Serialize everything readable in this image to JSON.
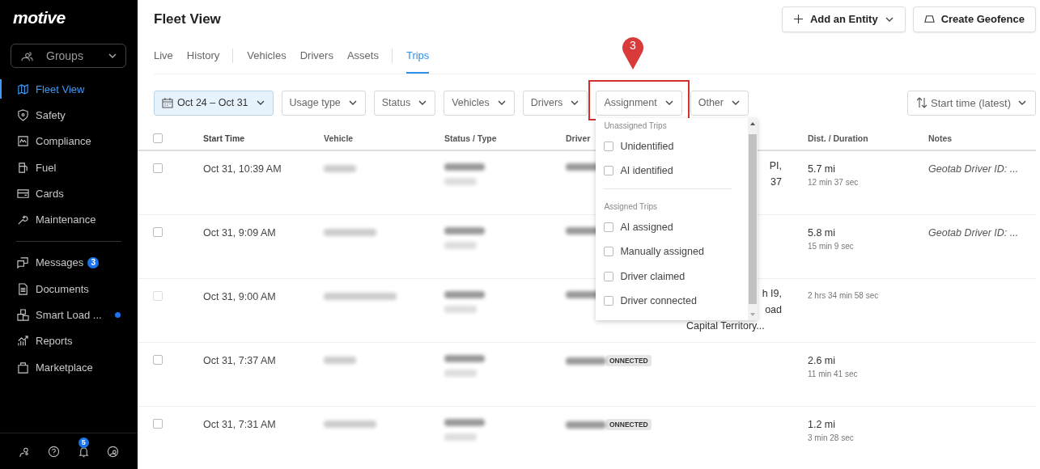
{
  "sidebar": {
    "logo": "motive",
    "groups": {
      "label": "Groups"
    },
    "nav": [
      {
        "label": "Fleet View",
        "selected": true
      },
      {
        "label": "Safety",
        "selected": false
      },
      {
        "label": "Compliance",
        "selected": false
      },
      {
        "label": "Fuel",
        "selected": false
      },
      {
        "label": "Cards",
        "selected": false
      },
      {
        "label": "Maintenance",
        "selected": false
      }
    ],
    "nav2": [
      {
        "label": "Messages",
        "selected": false,
        "badge": "3"
      },
      {
        "label": "Documents",
        "selected": false
      },
      {
        "label": "Smart Load ...",
        "selected": false,
        "dot": true
      },
      {
        "label": "Reports",
        "selected": false
      },
      {
        "label": "Marketplace",
        "selected": false
      }
    ],
    "notifications_badge": "5"
  },
  "header": {
    "title": "Fleet View",
    "buttons": [
      "Add an Entity",
      "Create Geofence"
    ]
  },
  "tab_groups": [
    [
      {
        "label": "Live",
        "selected": false
      },
      {
        "label": "History",
        "selected": false
      }
    ],
    [
      {
        "label": "Vehicles",
        "selected": false
      },
      {
        "label": "Drivers",
        "selected": false
      },
      {
        "label": "Assets",
        "selected": false
      }
    ],
    [
      {
        "label": "Trips",
        "selected": true
      }
    ]
  ],
  "filters": [
    {
      "label": "Oct 24 – Oct 31",
      "selected": true
    },
    {
      "label": "Usage type",
      "selected": false
    },
    {
      "label": "Status",
      "selected": false
    },
    {
      "label": "Vehicles",
      "selected": false
    },
    {
      "label": "Drivers",
      "selected": false
    },
    {
      "label": "Assignment",
      "selected": false
    },
    {
      "label": "Other",
      "selected": false
    }
  ],
  "sort": {
    "label": "Start time (latest)"
  },
  "annotation": {
    "step": "3"
  },
  "table": {
    "select_all_checked": false,
    "columns": [
      "Start Time",
      "Vehicle",
      "Status / Type",
      "Driver",
      "Dist. / Duration",
      "Notes"
    ],
    "rows": [
      {
        "checked": false,
        "disabled": false,
        "start": "Oct 31, 10:39 AM",
        "location": [
          {
            "text": "PI,",
            "cut": true
          },
          {
            "text": "37",
            "cut": true
          }
        ],
        "distance": "5.7 mi",
        "duration": "12 min 37 sec",
        "notes": "Geotab Driver ID: ..."
      },
      {
        "checked": false,
        "disabled": false,
        "start": "Oct 31, 9:09 AM",
        "distance": "5.8 mi",
        "duration": "15 min 9 sec",
        "notes": "Geotab Driver ID: ..."
      },
      {
        "checked": false,
        "disabled": true,
        "start": "Oct 31, 9:00 AM",
        "location": [
          {
            "text": "h I9,",
            "cut": true
          },
          {
            "text": "oad",
            "cut": true
          },
          {
            "text": "Capital Territory...",
            "cut": false
          }
        ],
        "duration": "2 hrs 34 min 58 sec"
      },
      {
        "checked": false,
        "disabled": false,
        "start": "Oct 31, 7:37 AM",
        "badge": "ONNECTED",
        "distance": "2.6 mi",
        "duration": "11 min 41 sec"
      },
      {
        "checked": false,
        "disabled": false,
        "start": "Oct 31, 7:31 AM",
        "badge": "ONNECTED",
        "distance": "1.2 mi",
        "duration": "3 min 28 sec"
      }
    ]
  },
  "dropdown": {
    "sections": [
      {
        "title": "Unassigned Trips",
        "options": [
          {
            "label": "Unidentified",
            "checked": false
          },
          {
            "label": "AI identified",
            "checked": false
          }
        ]
      },
      {
        "title": "Assigned Trips",
        "options": [
          {
            "label": "AI assigned",
            "checked": false
          },
          {
            "label": "Manually assigned",
            "checked": false
          },
          {
            "label": "Driver claimed",
            "checked": false
          },
          {
            "label": "Driver connected",
            "checked": false
          }
        ]
      }
    ]
  }
}
